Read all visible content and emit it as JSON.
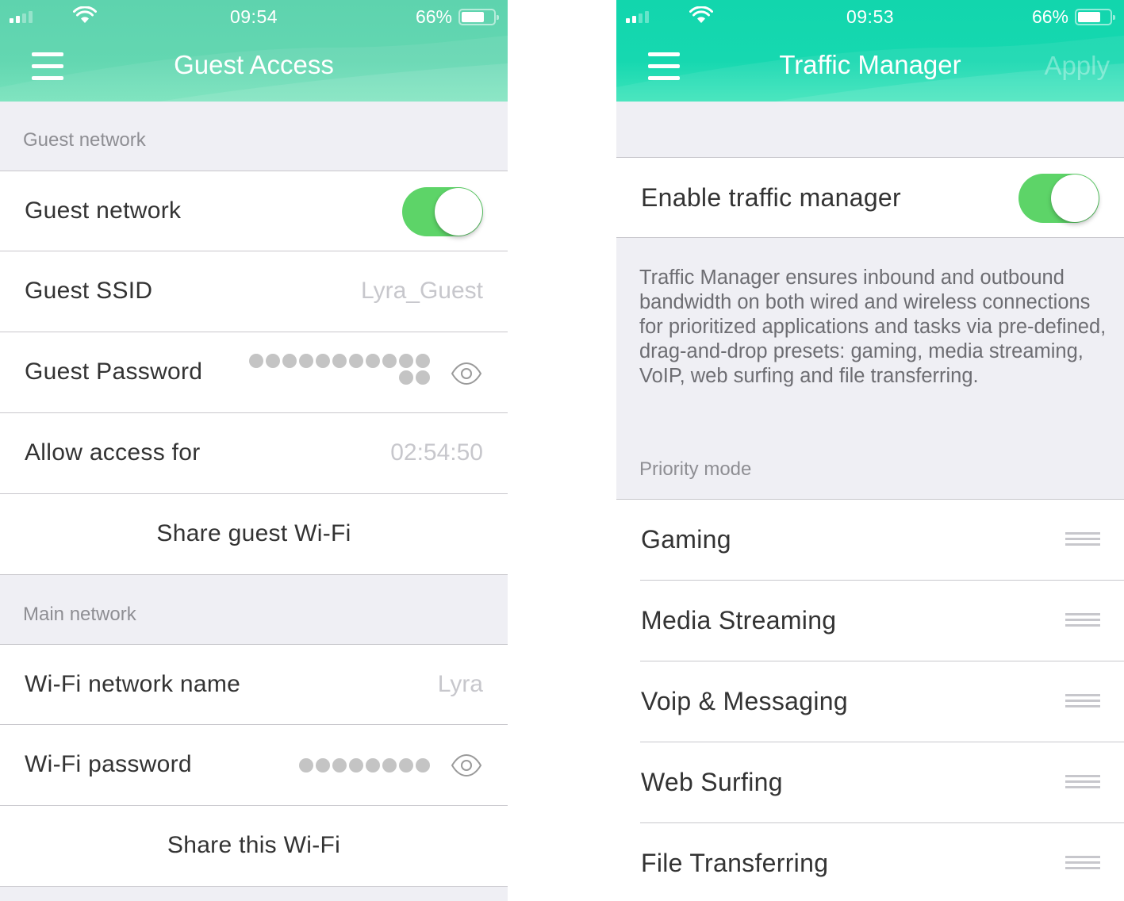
{
  "left_screen": {
    "status_bar": {
      "time": "09:54",
      "battery_percent": "66%",
      "battery_level": 0.66,
      "signal_bars": 2
    },
    "header": {
      "title": "Guest Access",
      "menu_icon": "hamburger-menu-icon"
    },
    "guest_section": {
      "header": "Guest network",
      "rows": {
        "guest_network": {
          "label": "Guest network",
          "toggle_on": true
        },
        "guest_ssid": {
          "label": "Guest SSID",
          "value": "Lyra_Guest"
        },
        "guest_password": {
          "label": "Guest Password",
          "masked_length": 13,
          "reveal_icon": "eye-icon"
        },
        "allow_access": {
          "label": "Allow access for",
          "value": "02:54:50"
        },
        "share": {
          "label": "Share guest Wi-Fi"
        }
      }
    },
    "main_section": {
      "header": "Main network",
      "rows": {
        "network_name": {
          "label": "Wi-Fi network name",
          "value": "Lyra"
        },
        "password": {
          "label": "Wi-Fi password",
          "masked_length": 8,
          "reveal_icon": "eye-icon"
        },
        "share": {
          "label": "Share this Wi-Fi"
        }
      }
    }
  },
  "right_screen": {
    "status_bar": {
      "time": "09:53",
      "battery_percent": "66%",
      "battery_level": 0.66,
      "signal_bars": 2
    },
    "header": {
      "title": "Traffic Manager",
      "apply_label": "Apply",
      "menu_icon": "hamburger-menu-icon"
    },
    "enable_row": {
      "label": "Enable traffic manager",
      "toggle_on": true
    },
    "description": "Traffic Manager ensures inbound and outbound bandwidth on both wired and wireless connections for prioritized applications and tasks via pre-defined, drag-and-drop presets: gaming, media streaming, VoIP, web surfing and file transferring.",
    "priority_header": "Priority mode",
    "priority_items": [
      {
        "label": "Gaming"
      },
      {
        "label": "Media Streaming"
      },
      {
        "label": "Voip & Messaging"
      },
      {
        "label": "Web Surfing"
      },
      {
        "label": "File Transferring"
      }
    ]
  },
  "colors": {
    "left_header": "#63d7b1",
    "right_header": "#16d8b0",
    "toggle_on": "#5dd468",
    "background_grouped": "#efeff4",
    "separator": "#c8c7cc",
    "secondary_text": "#8e8e93",
    "placeholder_text": "#c7c7cc"
  }
}
